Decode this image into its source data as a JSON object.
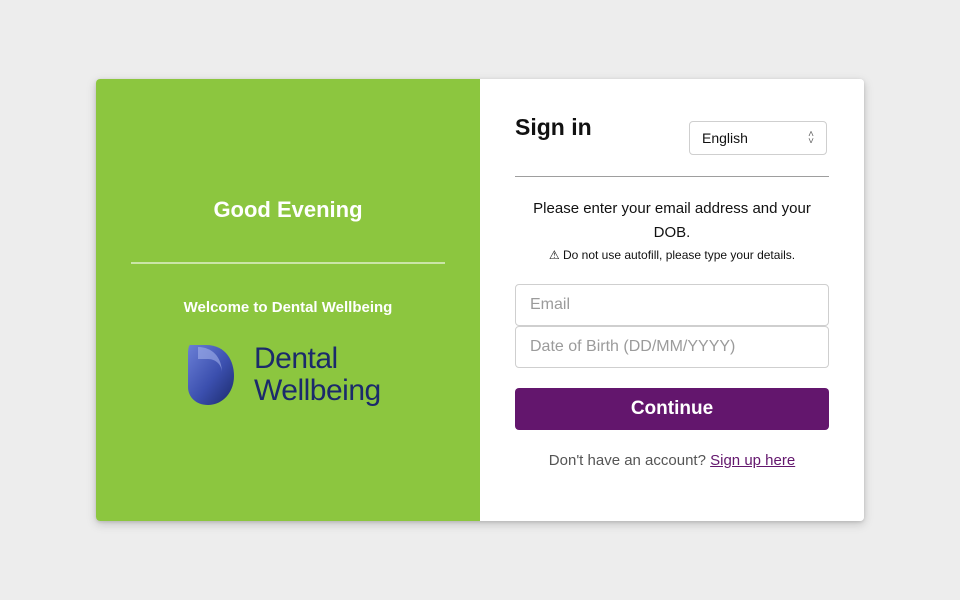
{
  "left_panel": {
    "greeting": "Good Evening",
    "welcome": "Welcome to Dental Wellbeing",
    "logo": {
      "line1": "Dental",
      "line2": "Wellbeing",
      "text_color": "#1b2a6b"
    },
    "background_color": "#8cc63f"
  },
  "sign_in": {
    "title": "Sign in",
    "language_select": {
      "selected": "English",
      "icon": "chevron-updown-icon"
    },
    "instructions": "Please enter your email address and your DOB.",
    "warning": "⚠ Do not use autofill, please type your details.",
    "email_field": {
      "placeholder": "Email",
      "value": ""
    },
    "dob_field": {
      "placeholder": "Date of Birth (DD/MM/YYYY)",
      "value": ""
    },
    "continue_label": "Continue",
    "continue_color": "#63166d",
    "signup_prompt": "Don't have an account?",
    "signup_link": "Sign up here"
  }
}
